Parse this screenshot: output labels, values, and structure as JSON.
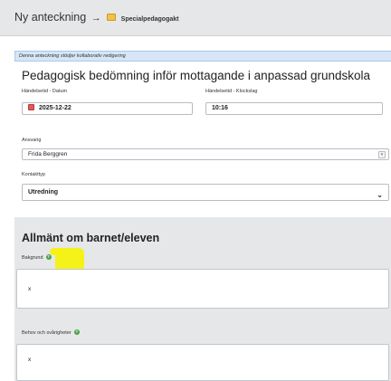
{
  "header": {
    "title": "Ny anteckning",
    "arrow": "→",
    "folder_icon": "folder-icon",
    "crumb": "Specialpedagogakt"
  },
  "info_bar": {
    "text": "Denna anteckning stödjer kollaborativ redigering"
  },
  "document": {
    "title": "Pedagogisk bedömning inför mottagande i anpassad grundskola"
  },
  "fields": {
    "date": {
      "label": "Händelsetid - Datum",
      "icon": "calendar-icon",
      "value": "2025-12-22"
    },
    "time": {
      "label": "Händelsetid - Klockslag",
      "value": "10:16"
    },
    "responsible": {
      "label": "Ansvarig",
      "value": "Frida Berggren"
    },
    "contact_type": {
      "label": "Kontakttyp",
      "value": "Utredning"
    }
  },
  "section": {
    "title": "Allmänt om barnet/eleven",
    "background": {
      "label": "Bakgrund",
      "value": "x"
    },
    "needs": {
      "label": "Behov och svårigheter",
      "value": "x"
    }
  },
  "colors": {
    "header_bg": "#e6e7e9",
    "info_bg": "#d6e6f6",
    "highlight": "#f5f20f",
    "help_icon": "#4aa34a",
    "calendar_icon": "#e05a5a"
  }
}
